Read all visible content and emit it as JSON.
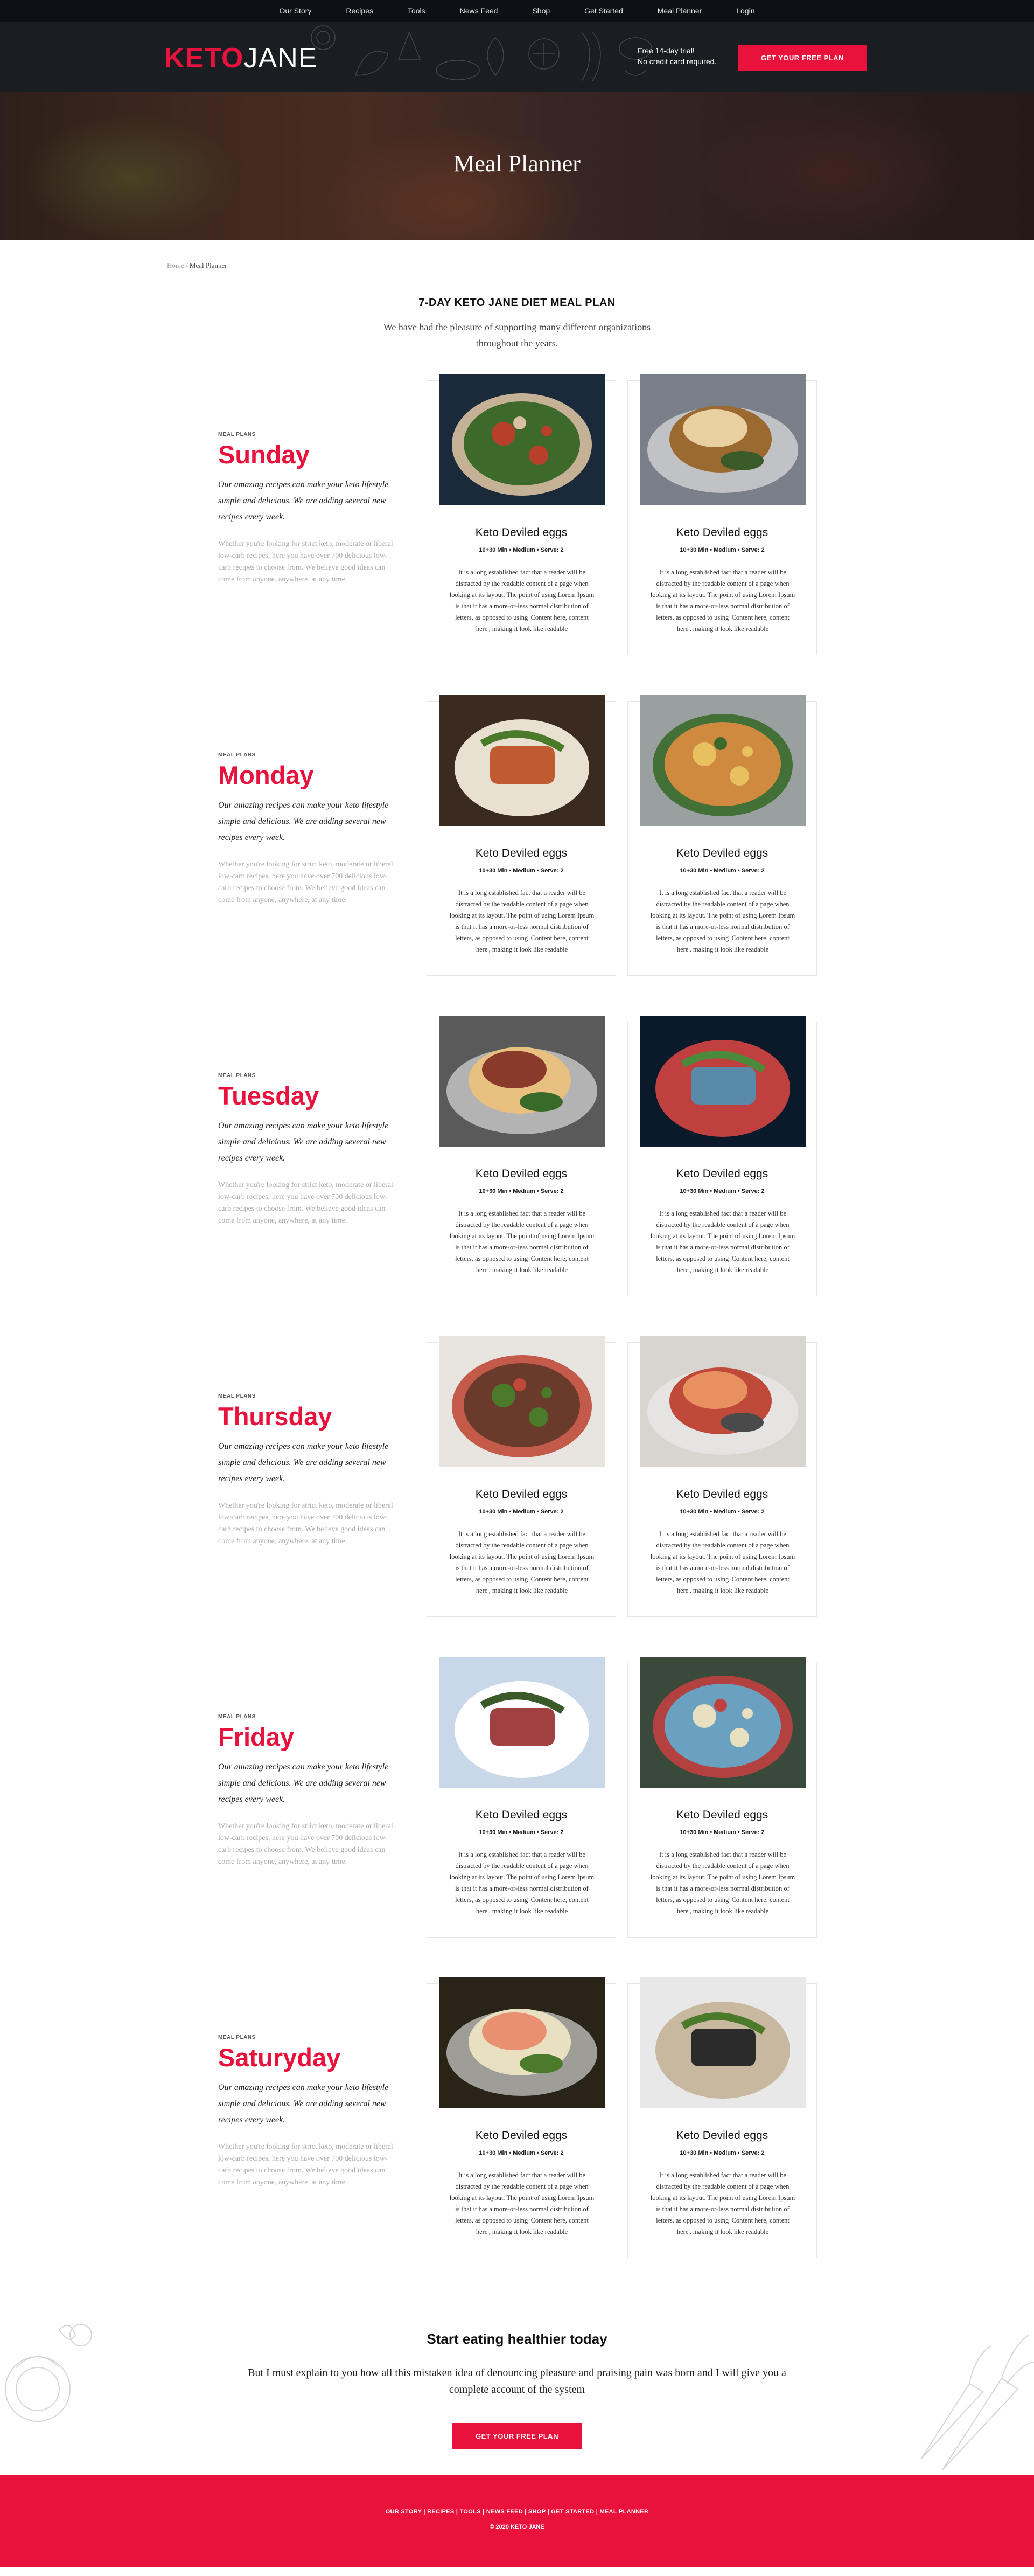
{
  "topnav": [
    "Our Story",
    "Recipes",
    "Tools",
    "News Feed",
    "Shop",
    "Get Started",
    "Meal Planner",
    "Login"
  ],
  "header": {
    "logo_keto": "KETO",
    "logo_jane": "JANE",
    "trial_line1": "Free 14-day trial!",
    "trial_line2": "No credit card required.",
    "cta": "GET YOUR FREE PLAN"
  },
  "hero": {
    "title": "Meal Planner"
  },
  "breadcrumb": {
    "home": "Home",
    "sep": "/",
    "current": "Meal Planner"
  },
  "intro": {
    "title": "7-DAY KETO JANE DIET MEAL PLAN",
    "text": "We have had the pleasure of supporting many different organizations throughout the years."
  },
  "days": [
    {
      "tag": "MEAL PLANS",
      "name": "Sunday"
    },
    {
      "tag": "MEAL PLANS",
      "name": "Monday"
    },
    {
      "tag": "MEAL PLANS",
      "name": "Tuesday"
    },
    {
      "tag": "MEAL PLANS",
      "name": "Thursday"
    },
    {
      "tag": "MEAL PLANS",
      "name": "Friday"
    },
    {
      "tag": "MEAL PLANS",
      "name": "Saturyday"
    }
  ],
  "day_lead": "Our amazing recipes can make your keto lifestyle simple and delicious. We are adding several new recipes every week.",
  "day_sub": "Whether you're looking for strict keto, moderate or liberal low-carb recipes, here you have over 700 delicious low-carb recipes to choose from. We believe good ideas can come from anyone, anywhere, at any time.",
  "card": {
    "title": "Keto Deviled eggs",
    "meta": "10+30 Min  •  Medium  •  Serve: 2",
    "desc": "It is a long established fact that a reader will be distracted by the readable content of a page when looking at its layout. The point of using Lorem Ipsum is that it has a more-or-less normal distribution of letters, as opposed to using 'Content here, content here', making it look like readable"
  },
  "colors": {
    "accent": "#e8123c",
    "header_bg": "#1a1d21",
    "topnav_bg": "#0d1015"
  },
  "photo_palettes": [
    [
      "#1a2a3a",
      "#3d6a2a",
      "#b8402a",
      "#d8c0a0"
    ],
    [
      "#7a7f8a",
      "#e8d0a0",
      "#9a6a30",
      "#3a5a2a"
    ],
    [
      "#3a2a20",
      "#c05a30",
      "#e8e0d0",
      "#4a7a2a"
    ],
    [
      "#9aa0a0",
      "#d08a40",
      "#e8c060",
      "#3a6a2a"
    ],
    [
      "#5a5a5a",
      "#8a3a2a",
      "#e8c080",
      "#3a6a2a"
    ],
    [
      "#0a1a2a",
      "#5a8aaa",
      "#c04040",
      "#4a8a3a"
    ],
    [
      "#e8e4e0",
      "#6a3a2a",
      "#4a7a2a",
      "#c04a3a"
    ],
    [
      "#d8d4d0",
      "#e89060",
      "#c04a3a",
      "#4a4a4a"
    ],
    [
      "#c8d8e8",
      "#a04040",
      "#ffffff",
      "#3a5a2a"
    ],
    [
      "#3a4a3a",
      "#6aa0c0",
      "#e8e0c0",
      "#c04040"
    ],
    [
      "#2a2418",
      "#e89070",
      "#e8e0c0",
      "#4a7a2a"
    ],
    [
      "#e8e8e8",
      "#2a2a2a",
      "#c8b8a0",
      "#4a7a2a"
    ]
  ],
  "cta": {
    "title": "Start eating healthier today",
    "text": "But I must explain to you how all this mistaken idea of denouncing pleasure and praising pain was born and I will give you a complete account of the system",
    "button": "GET YOUR FREE PLAN"
  },
  "footer": {
    "links": "OUR STORY | RECIPES | TOOLS | NEWS FEED | SHOP | GET STARTED | MEAL PLANNER",
    "copy": "© 2020 KETO JANE"
  }
}
